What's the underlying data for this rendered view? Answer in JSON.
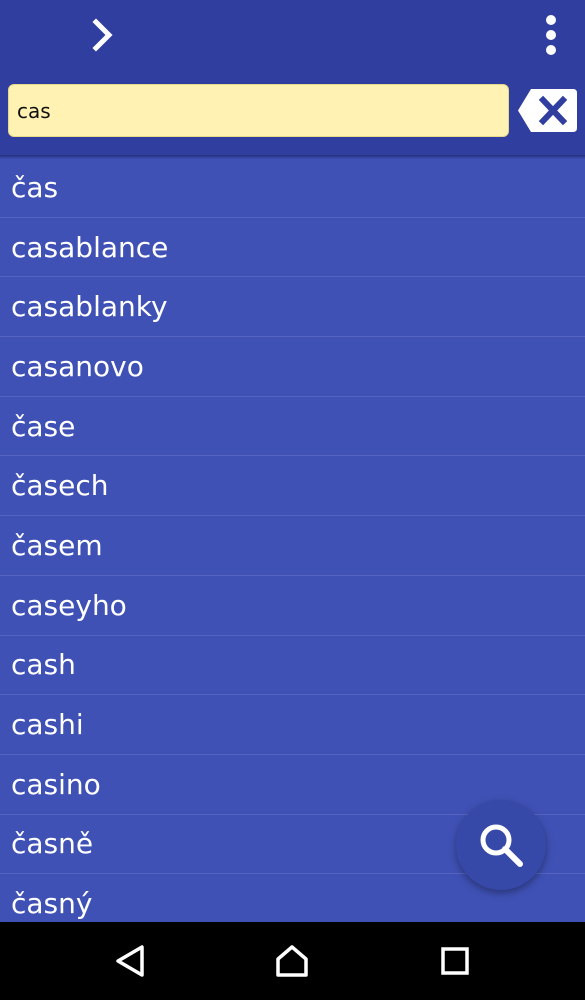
{
  "colors": {
    "app_bar": "#303f9f",
    "list_background": "#3f51b5",
    "divider": "#5564c0",
    "search_field": "#fff2b2",
    "fab": "#3648a8",
    "nav_bar": "#000000",
    "text": "#ffffff"
  },
  "toolbar": {
    "forward_icon": "chevron-right-icon",
    "menu_icon": "more-vertical-icon"
  },
  "search": {
    "value": "cas",
    "clear_icon": "backspace-clear-icon"
  },
  "results": [
    "čas",
    "casablance",
    "casablanky",
    "casanovo",
    "čase",
    "časech",
    "časem",
    "caseyho",
    "cash",
    "cashi",
    "casino",
    "časně",
    "časný"
  ],
  "fab": {
    "icon": "search-icon"
  },
  "navigation": {
    "back_icon": "back-triangle-icon",
    "home_icon": "home-icon",
    "recents_icon": "recents-square-icon"
  }
}
